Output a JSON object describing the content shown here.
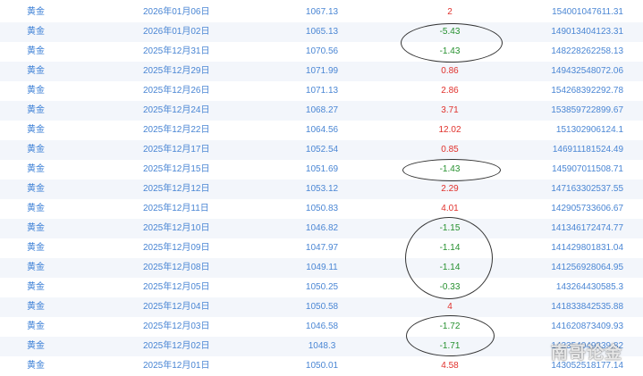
{
  "rows": [
    {
      "name": "黄金",
      "date": "2026年01月06日",
      "price": "1067.13",
      "change": "2",
      "dir": "up",
      "volume": "154001047611.31"
    },
    {
      "name": "黄金",
      "date": "2026年01月02日",
      "price": "1065.13",
      "change": "-5.43",
      "dir": "down",
      "volume": "149013404123.31"
    },
    {
      "name": "黄金",
      "date": "2025年12月31日",
      "price": "1070.56",
      "change": "-1.43",
      "dir": "down",
      "volume": "148228262258.13"
    },
    {
      "name": "黄金",
      "date": "2025年12月29日",
      "price": "1071.99",
      "change": "0.86",
      "dir": "up",
      "volume": "149432548072.06"
    },
    {
      "name": "黄金",
      "date": "2025年12月26日",
      "price": "1071.13",
      "change": "2.86",
      "dir": "up",
      "volume": "154268392292.78"
    },
    {
      "name": "黄金",
      "date": "2025年12月24日",
      "price": "1068.27",
      "change": "3.71",
      "dir": "up",
      "volume": "153859722899.67"
    },
    {
      "name": "黄金",
      "date": "2025年12月22日",
      "price": "1064.56",
      "change": "12.02",
      "dir": "up",
      "volume": "151302906124.1"
    },
    {
      "name": "黄金",
      "date": "2025年12月17日",
      "price": "1052.54",
      "change": "0.85",
      "dir": "up",
      "volume": "146911181524.49"
    },
    {
      "name": "黄金",
      "date": "2025年12月15日",
      "price": "1051.69",
      "change": "-1.43",
      "dir": "down",
      "volume": "145907011508.71"
    },
    {
      "name": "黄金",
      "date": "2025年12月12日",
      "price": "1053.12",
      "change": "2.29",
      "dir": "up",
      "volume": "147163302537.55"
    },
    {
      "name": "黄金",
      "date": "2025年12月11日",
      "price": "1050.83",
      "change": "4.01",
      "dir": "up",
      "volume": "142905733606.67"
    },
    {
      "name": "黄金",
      "date": "2025年12月10日",
      "price": "1046.82",
      "change": "-1.15",
      "dir": "down",
      "volume": "141346172474.77"
    },
    {
      "name": "黄金",
      "date": "2025年12月09日",
      "price": "1047.97",
      "change": "-1.14",
      "dir": "down",
      "volume": "141429801831.04"
    },
    {
      "name": "黄金",
      "date": "2025年12月08日",
      "price": "1049.11",
      "change": "-1.14",
      "dir": "down",
      "volume": "141256928064.95"
    },
    {
      "name": "黄金",
      "date": "2025年12月05日",
      "price": "1050.25",
      "change": "-0.33",
      "dir": "down",
      "volume": "143264430585.3"
    },
    {
      "name": "黄金",
      "date": "2025年12月04日",
      "price": "1050.58",
      "change": "4",
      "dir": "up",
      "volume": "141833842535.88"
    },
    {
      "name": "黄金",
      "date": "2025年12月03日",
      "price": "1046.58",
      "change": "-1.72",
      "dir": "down",
      "volume": "141620873409.93"
    },
    {
      "name": "黄金",
      "date": "2025年12月02日",
      "price": "1048.3",
      "change": "-1.71",
      "dir": "down",
      "volume": "142354049839.82"
    },
    {
      "name": "黄金",
      "date": "2025年12月01日",
      "price": "1050.01",
      "change": "4.58",
      "dir": "up",
      "volume": "143052518177.14"
    }
  ],
  "watermark": "南哥论金",
  "colors": {
    "up": "#e0312c",
    "down": "#25902e",
    "link": "#4a86d4",
    "row_alt": "#f3f6fb"
  }
}
